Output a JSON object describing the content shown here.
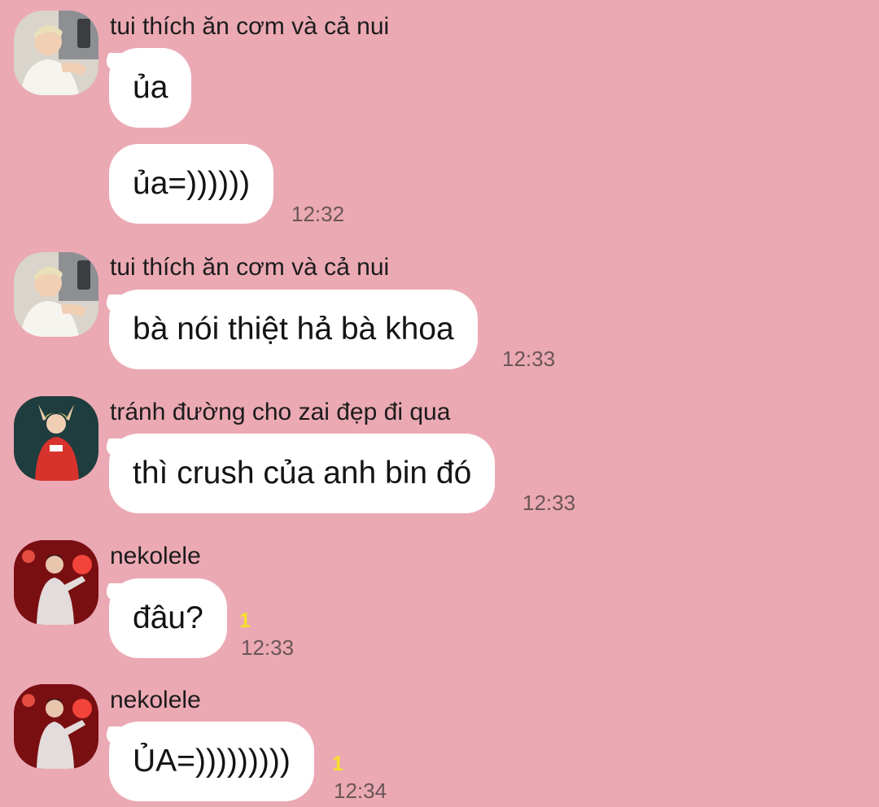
{
  "colors": {
    "background": "#EBA9B4",
    "bubble": "#FFFFFF",
    "timestamp": "#6A5558",
    "unread_badge": "#F7DF2A"
  },
  "messages": [
    {
      "sender": "tui thích ăn cơm và cả nui",
      "avatar": "avatar-photo-blond-man-white-shirt",
      "bubbles": [
        "ủa",
        "ủa=))))))"
      ],
      "time": "12:32"
    },
    {
      "sender": "tui thích ăn cơm và cả nui",
      "avatar": "avatar-photo-blond-man-white-shirt",
      "bubbles": [
        "bà nói thiệt hả bà khoa"
      ],
      "time": "12:33"
    },
    {
      "sender": "tránh đường cho zai đẹp đi qua",
      "avatar": "avatar-photo-man-red-jersey",
      "bubbles": [
        "thì crush của anh bin đó"
      ],
      "time": "12:33"
    },
    {
      "sender": "nekolele",
      "avatar": "avatar-photo-man-red-stage-lights",
      "bubbles": [
        "đâu?"
      ],
      "unread": "1",
      "time": "12:33"
    },
    {
      "sender": "nekolele",
      "avatar": "avatar-photo-man-red-stage-lights",
      "bubbles": [
        "ỦA=)))))))))"
      ],
      "unread": "1",
      "time": "12:34"
    }
  ]
}
